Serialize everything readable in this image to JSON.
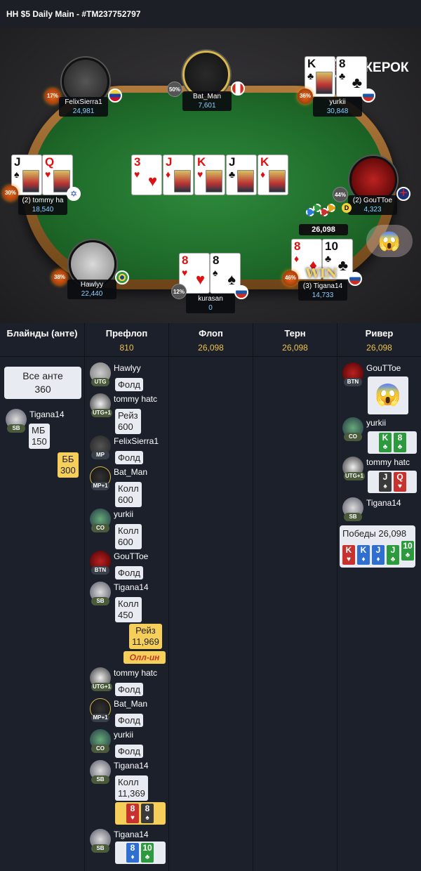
{
  "title": "HH $5 Daily Main - #TM237752797",
  "brand": {
    "mark": "GG",
    "name": "ПОКЕРОК"
  },
  "board": [
    {
      "rank": "3",
      "suit": "♥",
      "color": "red"
    },
    {
      "rank": "J",
      "suit": "♦",
      "color": "red"
    },
    {
      "rank": "K",
      "suit": "♥",
      "color": "red"
    },
    {
      "rank": "J",
      "suit": "♣",
      "color": "blk"
    },
    {
      "rank": "K",
      "suit": "♦",
      "color": "red"
    }
  ],
  "pot": "26,098",
  "dealer_label": "D",
  "win_label": "WIN",
  "seats": {
    "felix": {
      "name": "FelixSierra1",
      "stack": "24,981",
      "pct": "17%"
    },
    "batman": {
      "name": "Bat_Man",
      "stack": "7,601",
      "pct": "50%"
    },
    "yurkii": {
      "name": "yurkii",
      "stack": "30,848",
      "pct": "36%",
      "cards": [
        {
          "rank": "K",
          "suit": "♣",
          "color": "blk"
        },
        {
          "rank": "8",
          "suit": "♣",
          "color": "blk"
        }
      ]
    },
    "tommy": {
      "name": "(2) tommy ha",
      "stack": "18,540",
      "pct": "30%",
      "cards": [
        {
          "rank": "J",
          "suit": "♠",
          "color": "blk"
        },
        {
          "rank": "Q",
          "suit": "♥",
          "color": "red"
        }
      ]
    },
    "goutoe": {
      "name": "(2) GouTToe",
      "stack": "4,323",
      "pct": "44%"
    },
    "hawlyy": {
      "name": "Hawlyy",
      "stack": "22,440",
      "pct": "38%"
    },
    "kurasan": {
      "name": "kurasan",
      "stack": "0",
      "pct": "12%",
      "cards": [
        {
          "rank": "8",
          "suit": "♥",
          "color": "red"
        },
        {
          "rank": "8",
          "suit": "♠",
          "color": "blk"
        }
      ]
    },
    "tigana": {
      "name": "(3) Tigana14",
      "stack": "14,733",
      "pct": "46%",
      "cards": [
        {
          "rank": "8",
          "suit": "♦",
          "color": "red"
        },
        {
          "rank": "10",
          "suit": "♣",
          "color": "blk"
        }
      ]
    }
  },
  "streets": [
    {
      "label": "Блайнды (анте)",
      "amount": ""
    },
    {
      "label": "Префлоп",
      "amount": "810"
    },
    {
      "label": "Флоп",
      "amount": "26,098"
    },
    {
      "label": "Терн",
      "amount": "26,098"
    },
    {
      "label": "Ривер",
      "amount": "26,098"
    }
  ],
  "blinds": {
    "ante_label": "Все анте",
    "ante_amount": "360",
    "sb_name": "Tigana14",
    "sb_pos": "SB",
    "sb_label": "МБ",
    "sb_amount": "150",
    "bb_label": "ББ",
    "bb_amount": "300"
  },
  "preflop": [
    {
      "name": "Hawlyy",
      "pos": "UTG",
      "action": "Фолд"
    },
    {
      "name": "tommy hatc",
      "pos": "UTG+1",
      "action": "Рейз",
      "amount": "600"
    },
    {
      "name": "FelixSierra1",
      "pos": "MP",
      "action": "Фолд"
    },
    {
      "name": "Bat_Man",
      "pos": "MP+1",
      "action": "Колл",
      "amount": "600"
    },
    {
      "name": "yurkii",
      "pos": "CO",
      "action": "Колл",
      "amount": "600"
    },
    {
      "name": "GouTToe",
      "pos": "BTN",
      "action": "Фолд"
    },
    {
      "name": "Tigana14",
      "pos": "SB",
      "action": "Колл",
      "amount": "450"
    },
    {
      "name": "tommy hatc",
      "pos": "UTG+1",
      "action": "Фолд"
    },
    {
      "name": "Bat_Man",
      "pos": "MP+1",
      "action": "Фолд"
    },
    {
      "name": "yurkii",
      "pos": "CO",
      "action": "Фолд"
    },
    {
      "name": "Tigana14",
      "pos": "SB",
      "action": "Колл",
      "amount": "11,369"
    },
    {
      "name": "Tigana14",
      "pos": "SB"
    }
  ],
  "bb_raise": {
    "label": "Рейз",
    "amount": "11,969",
    "allin": "Олл-ин"
  },
  "bb_cards": [
    {
      "rank": "8",
      "suit": "♥",
      "c": "r"
    },
    {
      "rank": "8",
      "suit": "♠",
      "c": "k"
    }
  ],
  "sb_cards": [
    {
      "rank": "8",
      "suit": "♦",
      "c": "b"
    },
    {
      "rank": "10",
      "suit": "♣",
      "c": "g"
    }
  ],
  "river": [
    {
      "name": "GouTToe",
      "pos": "BTN"
    },
    {
      "name": "yurkii",
      "pos": "CO",
      "cards": [
        {
          "rank": "K",
          "suit": "♣",
          "c": "g"
        },
        {
          "rank": "8",
          "suit": "♣",
          "c": "g"
        }
      ]
    },
    {
      "name": "tommy hatc",
      "pos": "UTG+1",
      "cards": [
        {
          "rank": "J",
          "suit": "♠",
          "c": "k"
        },
        {
          "rank": "Q",
          "suit": "♥",
          "c": "r"
        }
      ]
    },
    {
      "name": "Tigana14",
      "pos": "SB"
    }
  ],
  "victory": {
    "label": "Победы",
    "amount": "26,098",
    "cards": [
      {
        "rank": "K",
        "suit": "♥",
        "c": "r"
      },
      {
        "rank": "K",
        "suit": "♦",
        "c": "b"
      },
      {
        "rank": "J",
        "suit": "♦",
        "c": "b"
      },
      {
        "rank": "J",
        "suit": "♣",
        "c": "g"
      },
      {
        "rank": "10",
        "suit": "♣",
        "c": "g"
      }
    ]
  }
}
